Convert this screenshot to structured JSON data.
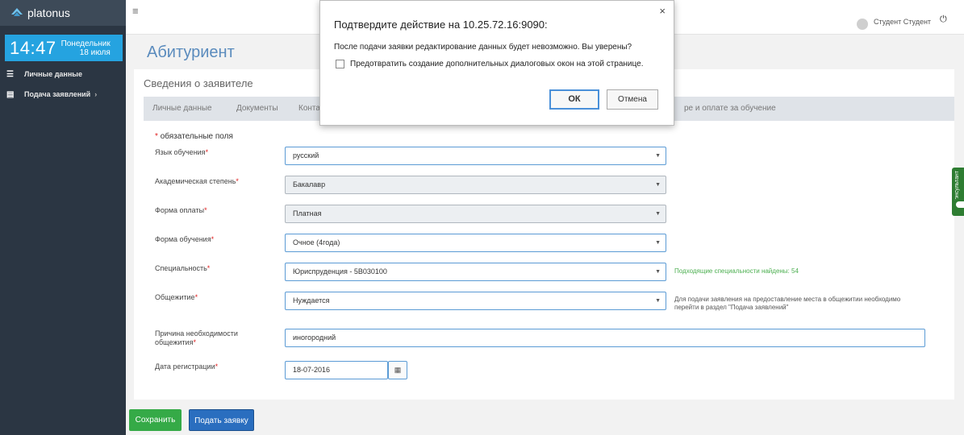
{
  "app": {
    "brand": "platonus"
  },
  "clock": {
    "time": "14:47",
    "weekday": "Понедельник",
    "date": "18 июля"
  },
  "sidebar": {
    "items": [
      {
        "label": "Личные данные",
        "icon": "list-icon"
      },
      {
        "label": "Подача заявлений",
        "icon": "document-icon"
      }
    ]
  },
  "topbar": {
    "user_name": "Студент Студент"
  },
  "page": {
    "title": "Абитуриент",
    "panel_title": "Сведения о заявителе"
  },
  "tabs": [
    {
      "label": "Личные данные"
    },
    {
      "label": "Документы"
    },
    {
      "label": "Конта"
    },
    {
      "label": "ре и оплате за обучение"
    }
  ],
  "form": {
    "required_note": "обязательные поля",
    "required_star": "*",
    "fields": {
      "language": {
        "label": "Язык обучения",
        "value": "русский"
      },
      "degree": {
        "label": "Академическая степень",
        "value": "Бакалавр"
      },
      "payment": {
        "label": "Форма оплаты",
        "value": "Платная"
      },
      "study_form": {
        "label": "Форма обучения",
        "value": "Очное (4года)"
      },
      "specialty": {
        "label": "Специальность",
        "value": "Юриспруденция - 5В030100",
        "hint": "Подходящие специальности найдены: 54"
      },
      "dormitory": {
        "label": "Общежитие",
        "value": "Нуждается",
        "hint_line1": "Для подачи заявления на предоставление места в общежитии необходимо",
        "hint_line2": "перейти в раздел \"Подача заявлений\""
      },
      "dorm_reason": {
        "label_line1": "Причина необходимости",
        "label_line2": "общежития",
        "value": "иногородний"
      },
      "reg_date": {
        "label": "Дата регистрации",
        "value": "18-07-2016"
      }
    }
  },
  "buttons": {
    "save": "Сохранить",
    "submit": "Подать заявку"
  },
  "consultant": {
    "label": "Консультант"
  },
  "dialog": {
    "title": "Подтвердите действие на 10.25.72.16:9090:",
    "message": "После подачи заявки редактирование данных будет невозможно. Вы уверены?",
    "checkbox_label": "Предотвратить создание дополнительных диалоговых окон на этой странице.",
    "ok": "ОК",
    "cancel": "Отмена",
    "close": "×"
  },
  "colors": {
    "sidebar_bg": "#2b3643",
    "clock_bg": "#25a3e0",
    "title_blue": "#5a8bbd",
    "required_red": "#e02222",
    "save_green": "#35aa47",
    "submit_blue": "#2a6ebf"
  }
}
